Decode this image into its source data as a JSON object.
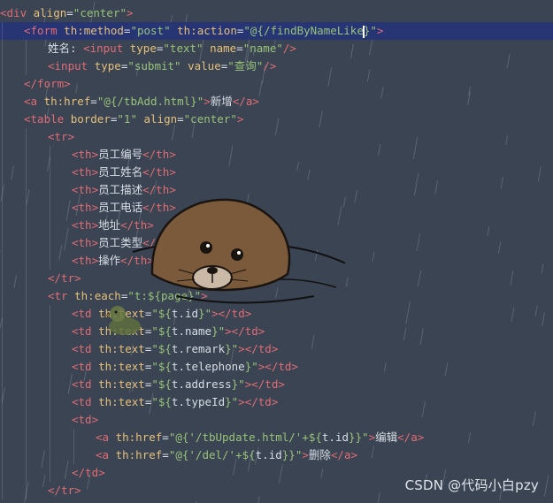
{
  "editor": {
    "lines": [
      {
        "indent": 0,
        "tokens": [
          {
            "t": "<",
            "c": "tag"
          },
          {
            "t": "div",
            "c": "tag"
          },
          {
            "t": " align",
            "c": "attr"
          },
          {
            "t": "=",
            "c": "txt"
          },
          {
            "t": "\"center\"",
            "c": "str"
          },
          {
            "t": ">",
            "c": "tag"
          }
        ]
      },
      {
        "indent": 1,
        "current": true,
        "tokens": [
          {
            "t": "<",
            "c": "tag"
          },
          {
            "t": "form",
            "c": "tag"
          },
          {
            "t": " th:method",
            "c": "attr"
          },
          {
            "t": "=",
            "c": "txt"
          },
          {
            "t": "\"post\"",
            "c": "str"
          },
          {
            "t": " th:action",
            "c": "attr"
          },
          {
            "t": "=",
            "c": "txt"
          },
          {
            "t": "\"@{/findByNameLike",
            "c": "str"
          },
          {
            "caret": true
          },
          {
            "t": "}\"",
            "c": "str"
          },
          {
            "t": ">",
            "c": "tag"
          }
        ]
      },
      {
        "indent": 2,
        "tokens": [
          {
            "t": "姓名: ",
            "c": "txt"
          },
          {
            "t": "<",
            "c": "tag"
          },
          {
            "t": "input",
            "c": "tag"
          },
          {
            "t": " type",
            "c": "attr"
          },
          {
            "t": "=",
            "c": "txt"
          },
          {
            "t": "\"text\"",
            "c": "str"
          },
          {
            "t": " name",
            "c": "attr"
          },
          {
            "t": "=",
            "c": "txt"
          },
          {
            "t": "\"name\"",
            "c": "str"
          },
          {
            "t": "/>",
            "c": "tag"
          }
        ]
      },
      {
        "indent": 2,
        "tokens": [
          {
            "t": "<",
            "c": "tag"
          },
          {
            "t": "input",
            "c": "tag"
          },
          {
            "t": " type",
            "c": "attr"
          },
          {
            "t": "=",
            "c": "txt"
          },
          {
            "t": "\"submit\"",
            "c": "str"
          },
          {
            "t": " value",
            "c": "attr"
          },
          {
            "t": "=",
            "c": "txt"
          },
          {
            "t": "\"查询\"",
            "c": "str"
          },
          {
            "t": "/>",
            "c": "tag"
          }
        ]
      },
      {
        "indent": 1,
        "tokens": [
          {
            "t": "</form>",
            "c": "tag"
          }
        ]
      },
      {
        "indent": 1,
        "tokens": [
          {
            "t": "<",
            "c": "tag"
          },
          {
            "t": "a",
            "c": "tag"
          },
          {
            "t": " th:href",
            "c": "attr"
          },
          {
            "t": "=",
            "c": "txt"
          },
          {
            "t": "\"@{/tbAdd.html}\"",
            "c": "str"
          },
          {
            "t": ">",
            "c": "tag"
          },
          {
            "t": "新增",
            "c": "txt"
          },
          {
            "t": "</a>",
            "c": "tag"
          }
        ]
      },
      {
        "indent": 1,
        "tokens": [
          {
            "t": "<",
            "c": "tag"
          },
          {
            "t": "table",
            "c": "tag"
          },
          {
            "t": " border",
            "c": "attr"
          },
          {
            "t": "=",
            "c": "txt"
          },
          {
            "t": "\"1\"",
            "c": "str"
          },
          {
            "t": " align",
            "c": "attr"
          },
          {
            "t": "=",
            "c": "txt"
          },
          {
            "t": "\"center\"",
            "c": "str"
          },
          {
            "t": ">",
            "c": "tag"
          }
        ]
      },
      {
        "indent": 2,
        "tokens": [
          {
            "t": "<tr>",
            "c": "tag"
          }
        ]
      },
      {
        "indent": 3,
        "tokens": [
          {
            "t": "<th>",
            "c": "tag"
          },
          {
            "t": "员工编号",
            "c": "txt"
          },
          {
            "t": "</th>",
            "c": "tag"
          }
        ]
      },
      {
        "indent": 3,
        "tokens": [
          {
            "t": "<th>",
            "c": "tag"
          },
          {
            "t": "员工姓名",
            "c": "txt"
          },
          {
            "t": "</th>",
            "c": "tag"
          }
        ]
      },
      {
        "indent": 3,
        "tokens": [
          {
            "t": "<th>",
            "c": "tag"
          },
          {
            "t": "员工描述",
            "c": "txt"
          },
          {
            "t": "</th>",
            "c": "tag"
          }
        ]
      },
      {
        "indent": 3,
        "tokens": [
          {
            "t": "<th>",
            "c": "tag"
          },
          {
            "t": "员工电话",
            "c": "txt"
          },
          {
            "t": "</th>",
            "c": "tag"
          }
        ]
      },
      {
        "indent": 3,
        "tokens": [
          {
            "t": "<th>",
            "c": "tag"
          },
          {
            "t": "地址",
            "c": "txt"
          },
          {
            "t": "</th>",
            "c": "tag"
          }
        ]
      },
      {
        "indent": 3,
        "tokens": [
          {
            "t": "<th>",
            "c": "tag"
          },
          {
            "t": "员工类型",
            "c": "txt"
          },
          {
            "t": "</th>",
            "c": "tag"
          }
        ]
      },
      {
        "indent": 3,
        "tokens": [
          {
            "t": "<th>",
            "c": "tag"
          },
          {
            "t": "操作",
            "c": "txt"
          },
          {
            "t": "</th>",
            "c": "tag"
          }
        ]
      },
      {
        "indent": 2,
        "tokens": [
          {
            "t": "</tr>",
            "c": "tag"
          }
        ]
      },
      {
        "indent": 2,
        "tokens": [
          {
            "t": "<",
            "c": "tag"
          },
          {
            "t": "tr",
            "c": "tag"
          },
          {
            "t": " th:each",
            "c": "attr"
          },
          {
            "t": "=",
            "c": "txt"
          },
          {
            "t": "\"t:${page}\"",
            "c": "str"
          },
          {
            "t": ">",
            "c": "tag"
          }
        ]
      },
      {
        "indent": 3,
        "tokens": [
          {
            "t": "<",
            "c": "tag"
          },
          {
            "t": "td",
            "c": "tag"
          },
          {
            "t": " th:text",
            "c": "attr"
          },
          {
            "t": "=",
            "c": "txt"
          },
          {
            "t": "\"${",
            "c": "str"
          },
          {
            "t": "t.id",
            "c": "expr"
          },
          {
            "t": "}\"",
            "c": "str"
          },
          {
            "t": "></td>",
            "c": "tag"
          }
        ]
      },
      {
        "indent": 3,
        "tokens": [
          {
            "t": "<",
            "c": "tag"
          },
          {
            "t": "td",
            "c": "tag"
          },
          {
            "t": " th:text",
            "c": "attr"
          },
          {
            "t": "=",
            "c": "txt"
          },
          {
            "t": "\"${",
            "c": "str"
          },
          {
            "t": "t.name",
            "c": "expr"
          },
          {
            "t": "}\"",
            "c": "str"
          },
          {
            "t": "></td>",
            "c": "tag"
          }
        ]
      },
      {
        "indent": 3,
        "tokens": [
          {
            "t": "<",
            "c": "tag"
          },
          {
            "t": "td",
            "c": "tag"
          },
          {
            "t": " th:text",
            "c": "attr"
          },
          {
            "t": "=",
            "c": "txt"
          },
          {
            "t": "\"${",
            "c": "str"
          },
          {
            "t": "t.remark",
            "c": "expr"
          },
          {
            "t": "}\"",
            "c": "str"
          },
          {
            "t": "></td>",
            "c": "tag"
          }
        ]
      },
      {
        "indent": 3,
        "tokens": [
          {
            "t": "<",
            "c": "tag"
          },
          {
            "t": "td",
            "c": "tag"
          },
          {
            "t": " th:text",
            "c": "attr"
          },
          {
            "t": "=",
            "c": "txt"
          },
          {
            "t": "\"${",
            "c": "str"
          },
          {
            "t": "t.telephone",
            "c": "expr"
          },
          {
            "t": "}\"",
            "c": "str"
          },
          {
            "t": "></td>",
            "c": "tag"
          }
        ]
      },
      {
        "indent": 3,
        "tokens": [
          {
            "t": "<",
            "c": "tag"
          },
          {
            "t": "td",
            "c": "tag"
          },
          {
            "t": " th:text",
            "c": "attr"
          },
          {
            "t": "=",
            "c": "txt"
          },
          {
            "t": "\"${",
            "c": "str"
          },
          {
            "t": "t.address",
            "c": "expr"
          },
          {
            "t": "}\"",
            "c": "str"
          },
          {
            "t": "></td>",
            "c": "tag"
          }
        ]
      },
      {
        "indent": 3,
        "tokens": [
          {
            "t": "<",
            "c": "tag"
          },
          {
            "t": "td",
            "c": "tag"
          },
          {
            "t": " th:text",
            "c": "attr"
          },
          {
            "t": "=",
            "c": "txt"
          },
          {
            "t": "\"${",
            "c": "str"
          },
          {
            "t": "t.typeId",
            "c": "expr"
          },
          {
            "t": "}\"",
            "c": "str"
          },
          {
            "t": "></td>",
            "c": "tag"
          }
        ]
      },
      {
        "indent": 3,
        "tokens": [
          {
            "t": "<td>",
            "c": "tag"
          }
        ]
      },
      {
        "indent": 4,
        "tokens": [
          {
            "t": "<",
            "c": "tag"
          },
          {
            "t": "a",
            "c": "tag"
          },
          {
            "t": " th:href",
            "c": "attr"
          },
          {
            "t": "=",
            "c": "txt"
          },
          {
            "t": "\"@{'/tbUpdate.html/'+${",
            "c": "str"
          },
          {
            "t": "t.id",
            "c": "expr"
          },
          {
            "t": "}}\"",
            "c": "str"
          },
          {
            "t": ">",
            "c": "tag"
          },
          {
            "t": "编辑",
            "c": "txt"
          },
          {
            "t": "</a>",
            "c": "tag"
          }
        ]
      },
      {
        "indent": 4,
        "tokens": [
          {
            "t": "<",
            "c": "tag"
          },
          {
            "t": "a",
            "c": "tag"
          },
          {
            "t": " th:href",
            "c": "attr"
          },
          {
            "t": "=",
            "c": "txt"
          },
          {
            "t": "\"@{'/del/'+${",
            "c": "str"
          },
          {
            "t": "t.id",
            "c": "expr"
          },
          {
            "t": "}}\"",
            "c": "str"
          },
          {
            "t": ">",
            "c": "tag"
          },
          {
            "t": "删除",
            "c": "txt"
          },
          {
            "t": "</a>",
            "c": "tag"
          }
        ]
      },
      {
        "indent": 3,
        "tokens": [
          {
            "t": "</td>",
            "c": "tag"
          }
        ]
      },
      {
        "indent": 2,
        "tokens": [
          {
            "t": "</tr>",
            "c": "tag"
          }
        ]
      }
    ]
  },
  "watermark": "CSDN @代码小白pzy",
  "colors": {
    "background": "#3b4452",
    "tag": "#e06c75",
    "attr": "#e5c07b",
    "string": "#98c379",
    "text": "#d8dde6",
    "current_line": "#263478"
  }
}
